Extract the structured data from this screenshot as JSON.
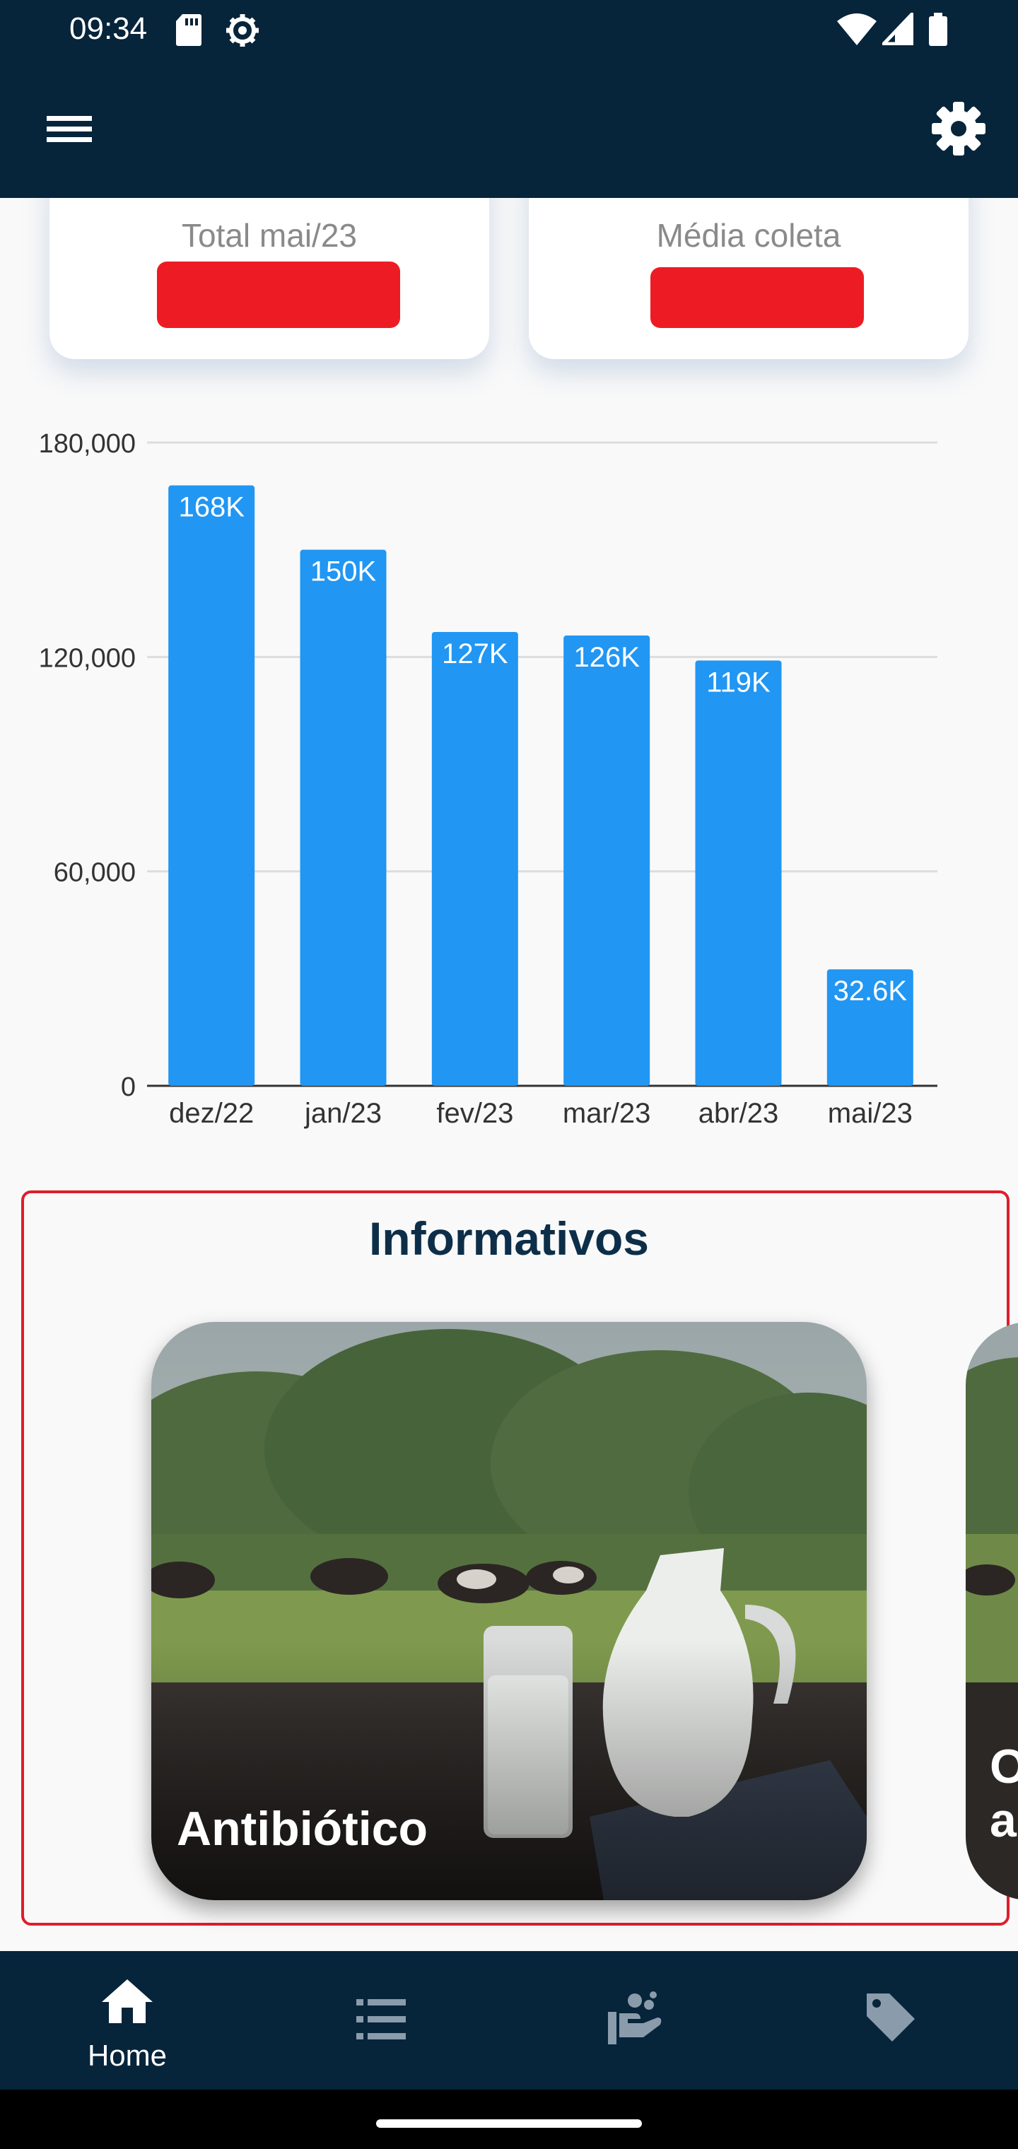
{
  "status_bar": {
    "time": "09:34",
    "icons_left": [
      "sd-card-icon",
      "settings-gear-status-icon"
    ],
    "icons_right": [
      "wifi-icon",
      "cell-signal-icon",
      "battery-icon"
    ]
  },
  "app_bar": {
    "menu_icon": "hamburger-menu-icon",
    "settings_icon": "gear-icon",
    "background": "#06243a"
  },
  "stats": {
    "left": {
      "label": "Total mai/23",
      "value_redacted": true
    },
    "right": {
      "label": "Média coleta",
      "value_redacted": true
    },
    "redaction_color": "#ed1c24"
  },
  "chart_data": {
    "type": "bar",
    "categories": [
      "dez/22",
      "jan/23",
      "fev/23",
      "mar/23",
      "abr/23",
      "mai/23"
    ],
    "values": [
      168000,
      150000,
      127000,
      126000,
      119000,
      32600
    ],
    "data_labels": [
      "168K",
      "150K",
      "127K",
      "126K",
      "119K",
      "32.6K"
    ],
    "yticks": [
      "0",
      "60,000",
      "120,000",
      "180,000"
    ],
    "ylim": [
      0,
      180000
    ],
    "grid": true,
    "bar_color": "#2196f3"
  },
  "informativos": {
    "title": "Informativos",
    "cards": [
      {
        "title": "Antibiótico"
      },
      {
        "title_line1": "O",
        "title_line2": "a"
      }
    ]
  },
  "bottom_nav": {
    "items": [
      {
        "label": "Home",
        "icon": "home-icon",
        "active": true
      },
      {
        "label": "",
        "icon": "list-icon",
        "active": false
      },
      {
        "label": "",
        "icon": "hand-wash-icon",
        "active": false
      },
      {
        "label": "",
        "icon": "tag-icon",
        "active": false
      }
    ]
  }
}
